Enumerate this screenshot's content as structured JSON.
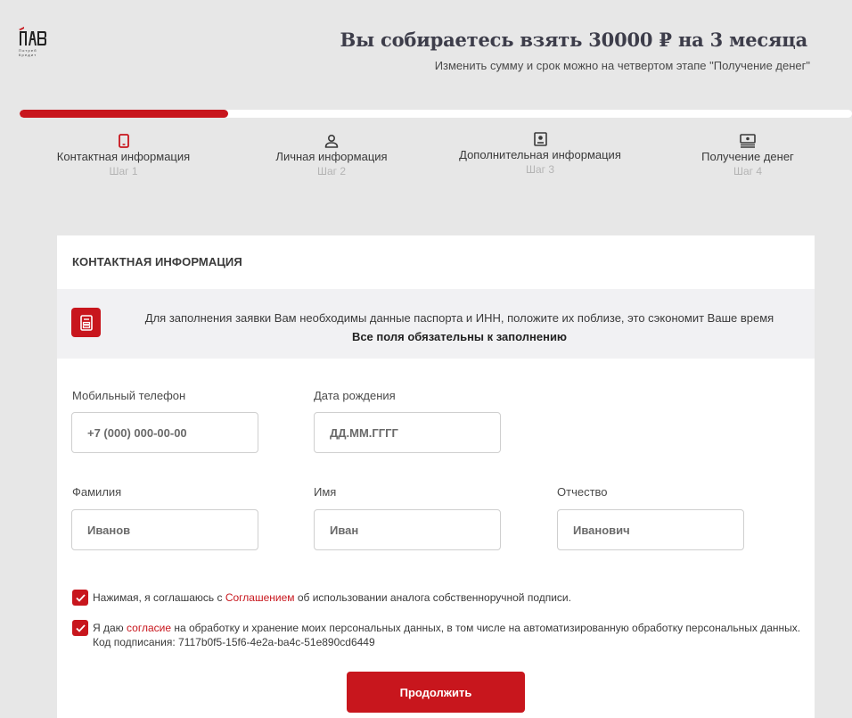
{
  "brand": {
    "logo_word": "ПАВ",
    "logo_sub_1": "Потреб",
    "logo_sub_2": "Кредит"
  },
  "header": {
    "title": "Вы собираетесь взять 30000 ₽ на 3 месяца",
    "subtitle": "Изменить сумму и срок можно на четвертом этапе \"Получение денег\""
  },
  "progress": {
    "percent": 25
  },
  "steps": [
    {
      "title": "Контактная информация",
      "num": "Шаг 1",
      "icon": "phone-icon",
      "active": true
    },
    {
      "title": "Личная информация",
      "num": "Шаг 2",
      "icon": "user-icon",
      "active": false
    },
    {
      "title": "Дополнительная информация",
      "num": "Шаг 3",
      "icon": "id-card-icon",
      "active": false
    },
    {
      "title": "Получение денег",
      "num": "Шаг 4",
      "icon": "money-icon",
      "active": false
    }
  ],
  "form": {
    "title": "КОНТАКТНАЯ ИНФОРМАЦИЯ",
    "notice": {
      "text": "Для заполнения заявки Вам необходимы данные паспорта и ИНН, положите их поблизе, это сэкономит Ваше время",
      "emphasis": "Все поля обязательны к заполнению",
      "icon": "document-icon"
    },
    "fields": {
      "phone": {
        "label": "Мобильный телефон",
        "placeholder": "+7 (000) 000-00-00"
      },
      "birthdate": {
        "label": "Дата рождения",
        "placeholder": "ДД.ММ.ГГГГ"
      },
      "surname": {
        "label": "Фамилия",
        "placeholder": "Иванов"
      },
      "name": {
        "label": "Имя",
        "placeholder": "Иван"
      },
      "patronymic": {
        "label": "Отчество",
        "placeholder": "Иванович"
      }
    },
    "consent1": {
      "before": "Нажимая, я соглашаюсь с ",
      "link": "Соглашением",
      "after": " об использовании аналога собственноручной подписи.",
      "checked": true
    },
    "consent2": {
      "before": "Я даю ",
      "link": "согласие",
      "after": " на обработку и хранение моих персональных данных, в том числе на автоматизированную обработку персональных данных.",
      "code_line": "Код подписания: 7117b0f5-15f6-4e2a-ba4c-51e890cd6449",
      "checked": true
    },
    "submit_label": "Продолжить"
  },
  "colors": {
    "accent": "#c8161d",
    "background": "#e7e7e7",
    "card": "#ffffff",
    "notice_bg": "#f1f1f3"
  }
}
